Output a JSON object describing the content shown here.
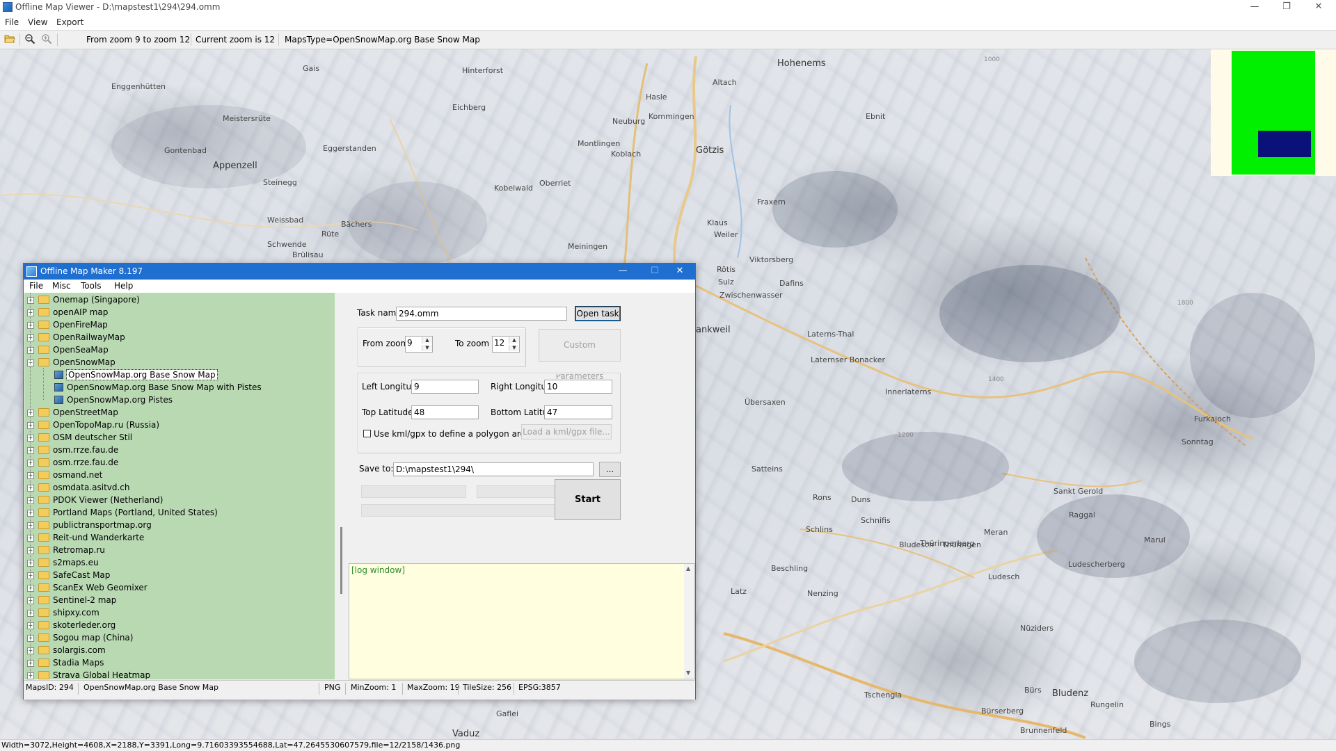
{
  "window": {
    "title": "Offline Map Viewer - D:\\mapstest1\\294\\294.omm",
    "minimize": "—",
    "restore": "❐",
    "close": "✕"
  },
  "menu": [
    "File",
    "View",
    "Export"
  ],
  "toolbar": {
    "zoom_range": "From zoom 9 to zoom 12",
    "current_zoom": "Current zoom is 12",
    "maps_type": "MapsType=OpenSnowMap.org Base Snow Map"
  },
  "map": {
    "labels": [
      "Hohenems",
      "Gais",
      "Hinterforst",
      "Altach",
      "Enggenhütten",
      "Hasle",
      "Eichberg",
      "Kommingen",
      "Meistersrüte",
      "Neuburg",
      "Ebnit",
      "Montlingen",
      "Gontenbad",
      "Koblach",
      "Götzis",
      "Eggerstanden",
      "Appenzell",
      "Steinegg",
      "Kobelwald",
      "Oberriet",
      "Fraxern",
      "Weissbad",
      "Bächers",
      "Klaus",
      "Rüte",
      "Weiler",
      "Schwende",
      "Brülisau",
      "Meiningen",
      "Viktorsberg",
      "Rötis",
      "Sulz",
      "Dafins",
      "Zwischenwasser",
      "Laterns-Thal",
      "ankweil",
      "Laternser Bonacker",
      "Innerlaterns",
      "Übersaxen",
      "Furkajoch",
      "Satteins",
      "Sonntag",
      "Rons",
      "Duns",
      "Schnifis",
      "Sankt Gerold",
      "Raggal",
      "Thüringerberg",
      "Schlins",
      "Meran",
      "Bludesch",
      "Thüringen",
      "Marul",
      "Ludescherberg",
      "Beschling",
      "Nenzing",
      "Ludesch",
      "Nüziders",
      "Latz",
      "Bürs",
      "Bludenz",
      "Rungelin",
      "Tschengla",
      "Bürserberg",
      "Brunnenfeld",
      "Gaflei",
      "Vaduz",
      "Bings"
    ],
    "elevations": [
      "1000",
      "1400",
      "1800",
      "1200"
    ]
  },
  "status_bar": "Width=3072,Height=4608,X=2188,Y=3391,Long=9.71603393554688,Lat=47.2645530607579,file=12/2158/1436.png",
  "dialog": {
    "title": "Offline Map Maker 8.197",
    "minimize": "—",
    "maximize": "☐",
    "close": "✕",
    "menu": [
      "File",
      "Misc",
      "Tools",
      "Help"
    ],
    "tree": [
      {
        "label": "Onemap (Singapore)",
        "level": 0,
        "expanded": false
      },
      {
        "label": "openAIP map",
        "level": 0,
        "expanded": false
      },
      {
        "label": "OpenFireMap",
        "level": 0,
        "expanded": false
      },
      {
        "label": "OpenRailwayMap",
        "level": 0,
        "expanded": false
      },
      {
        "label": "OpenSeaMap",
        "level": 0,
        "expanded": false
      },
      {
        "label": "OpenSnowMap",
        "level": 0,
        "expanded": true
      },
      {
        "label": "OpenSnowMap.org Base Snow Map",
        "level": 1,
        "selected": true
      },
      {
        "label": "OpenSnowMap.org Base Snow Map with Pistes",
        "level": 1
      },
      {
        "label": "OpenSnowMap.org Pistes",
        "level": 1
      },
      {
        "label": "OpenStreetMap",
        "level": 0,
        "expanded": false
      },
      {
        "label": "OpenTopoMap.ru (Russia)",
        "level": 0,
        "expanded": false
      },
      {
        "label": "OSM deutscher Stil",
        "level": 0,
        "expanded": false
      },
      {
        "label": "osm.rrze.fau.de",
        "level": 0,
        "expanded": false
      },
      {
        "label": "osm.rrze.fau.de",
        "level": 0,
        "expanded": false
      },
      {
        "label": "osmand.net",
        "level": 0,
        "expanded": false
      },
      {
        "label": "osmdata.asitvd.ch",
        "level": 0,
        "expanded": false
      },
      {
        "label": "PDOK Viewer (Netherland)",
        "level": 0,
        "expanded": false
      },
      {
        "label": "Portland Maps (Portland, United States)",
        "level": 0,
        "expanded": false
      },
      {
        "label": "publictransportmap.org",
        "level": 0,
        "expanded": false
      },
      {
        "label": "Reit-und Wanderkarte",
        "level": 0,
        "expanded": false
      },
      {
        "label": "Retromap.ru",
        "level": 0,
        "expanded": false
      },
      {
        "label": "s2maps.eu",
        "level": 0,
        "expanded": false
      },
      {
        "label": "SafeCast Map",
        "level": 0,
        "expanded": false
      },
      {
        "label": "ScanEx Web Geomixer",
        "level": 0,
        "expanded": false
      },
      {
        "label": "Sentinel-2 map",
        "level": 0,
        "expanded": false
      },
      {
        "label": "shipxy.com",
        "level": 0,
        "expanded": false
      },
      {
        "label": "skoterleder.org",
        "level": 0,
        "expanded": false
      },
      {
        "label": "Sogou map (China)",
        "level": 0,
        "expanded": false
      },
      {
        "label": "solargis.com",
        "level": 0,
        "expanded": false
      },
      {
        "label": "Stadia Maps",
        "level": 0,
        "expanded": false
      },
      {
        "label": "Strava Global Heatmap",
        "level": 0,
        "expanded": false
      }
    ],
    "task": {
      "label": "Task name",
      "value": "294.omm",
      "open_button": "Open task ..."
    },
    "zoom": {
      "from_label": "From zoom",
      "from_value": "9",
      "to_label": "To zoom",
      "to_value": "12",
      "custom_button": "Custom Parameters"
    },
    "bounds": {
      "left_lon_label": "Left Longitude",
      "left_lon": "9",
      "right_lon_label": "Right Longitude",
      "right_lon": "10",
      "top_lat_label": "Top Latitude",
      "top_lat": "48",
      "bottom_lat_label": "Bottom Latitude",
      "bottom_lat": "47",
      "kml_checkbox_label": "Use kml/gpx to define a polygon area",
      "kml_checked": false,
      "load_kml_button": "Load a kml/gpx file..."
    },
    "save": {
      "label": "Save to:",
      "value": "D:\\mapstest1\\294\\",
      "browse_button": "..."
    },
    "start_button": "Start",
    "log_text": "[log window]",
    "status": {
      "maps_id": "MapsID: 294",
      "maps_name": "OpenSnowMap.org Base Snow Map",
      "format": "PNG",
      "min_zoom": "MinZoom: 1",
      "max_zoom": "MaxZoom: 19",
      "tile_size": "TileSize: 256",
      "epsg": "EPSG:3857"
    }
  },
  "colors": {
    "dialog_titlebar": "#1f6fd0",
    "tree_bg": "#b9d9b3",
    "log_bg": "#ffffdf",
    "log_text": "#2b8a2b",
    "minimap_green": "#00f000",
    "minimap_blue": "#0a127a"
  }
}
